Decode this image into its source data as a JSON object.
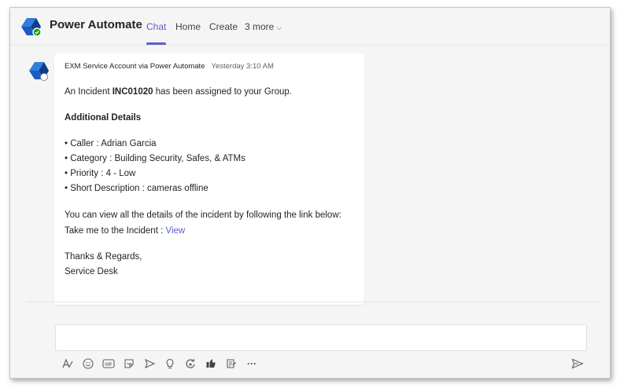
{
  "header": {
    "app_title": "Power Automate",
    "tabs": [
      {
        "label": "Chat",
        "active": true
      },
      {
        "label": "Home",
        "active": false
      },
      {
        "label": "Create",
        "active": false
      },
      {
        "label": "3 more",
        "active": false
      }
    ],
    "more_chevron": "⌵"
  },
  "message": {
    "sender": "EXM Service Account via Power Automate",
    "timestamp": "Yesterday 3:10 AM",
    "intro_prefix": "An Incident ",
    "incident_number": "INC01020",
    "intro_suffix": " has been assigned to your Group.",
    "details_heading": "Additional Details",
    "details": [
      "• Caller : Adrian Garcia",
      "• Category : Building Security, Safes, & ATMs",
      "• Priority : 4 - Low",
      "• Short Description : cameras offline"
    ],
    "view_text": "You can view all the details of the incident by following the link below:",
    "link_prefix": "Take me to the Incident : ",
    "link_label": "View",
    "closing_1": "Thanks & Regards,",
    "closing_2": "Service Desk"
  },
  "compose": {
    "toolbar_icons": [
      "format-icon",
      "emoji-icon",
      "gif-icon",
      "sticker-icon",
      "meet-now-icon",
      "praise-icon",
      "loop-icon",
      "approvals-icon",
      "updates-icon",
      "more-options-icon"
    ],
    "more_label": "···"
  },
  "colors": {
    "accent": "#5b5fc7",
    "logo_dark": "#0f3d8c",
    "logo_light": "#2f7fe0",
    "status_green": "#13a10e"
  }
}
